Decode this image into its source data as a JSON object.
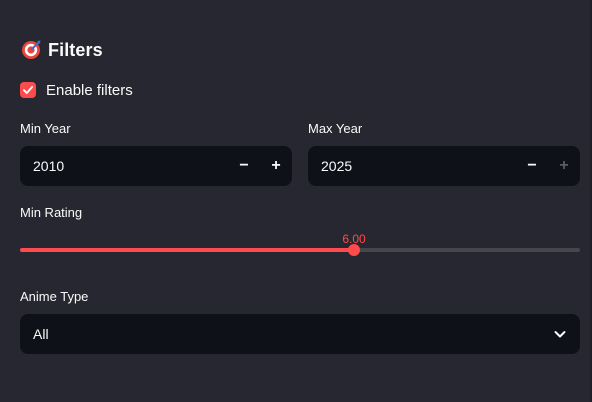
{
  "sidebar": {
    "header": {
      "title": "Filters",
      "icon": "target-icon"
    },
    "enable_filters": {
      "label": "Enable filters",
      "checked": true
    },
    "min_year": {
      "label": "Min Year",
      "value": "2010",
      "minus": "−",
      "plus": "+"
    },
    "max_year": {
      "label": "Max Year",
      "value": "2025",
      "minus": "−",
      "plus": "+"
    },
    "min_rating": {
      "label": "Min Rating",
      "value_text": "6.00",
      "fraction": 0.6
    },
    "anime_type": {
      "label": "Anime Type",
      "selected": "All"
    }
  },
  "colors": {
    "accent": "#ff4b4b",
    "background": "#262730",
    "input_bg": "#0e1117",
    "track": "#45474f"
  }
}
